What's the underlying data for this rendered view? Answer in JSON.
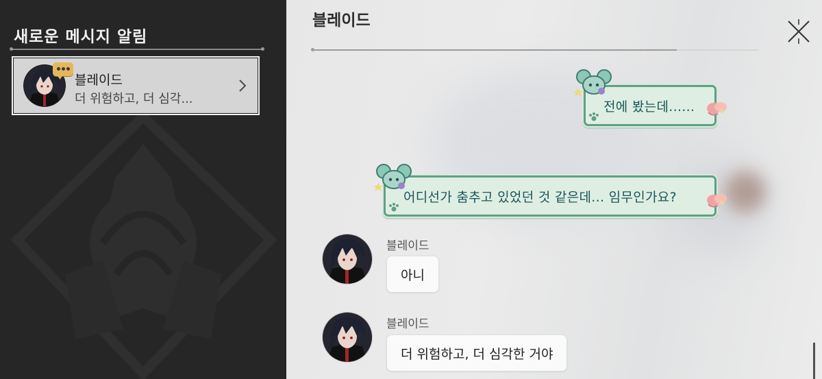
{
  "notifications": {
    "title": "새로운 메시지 알림",
    "contact": {
      "name": "블레이드",
      "preview": "더 위험하고, 더 심각..."
    }
  },
  "chat": {
    "title": "블레이드",
    "messages": [
      {
        "from": "self",
        "text": "전에 봤는데......"
      },
      {
        "from": "self",
        "text": "어디선가 춤추고 있었던 것 같은데... 임무인가요?"
      },
      {
        "from": "other",
        "sender": "블레이드",
        "text": "아니"
      },
      {
        "from": "other",
        "sender": "블레이드",
        "text": "더 위험하고, 더 심각한 거야"
      }
    ]
  },
  "icons": {
    "close": "close-icon",
    "chevron": "chevron-right-icon",
    "badge": "message-badge-icon"
  },
  "colors": {
    "left_bg": "#262626",
    "self_bubble_border": "#5f9f86",
    "self_bubble_fill": "#dfeee3",
    "self_text": "#19565a",
    "badge": "#e4b85a"
  }
}
